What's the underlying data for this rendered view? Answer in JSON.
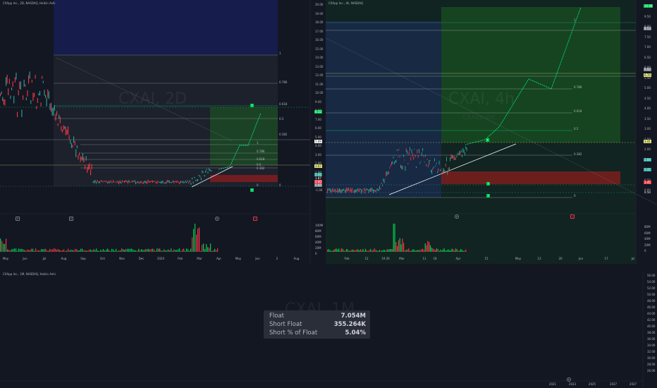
{
  "panes": {
    "left": {
      "title": "CXApp Inc., 2D, NASDAQ, Heikin Ashi",
      "watermark": "CXAI, 2D",
      "y_axis": [
        "20.00",
        "19.00",
        "18.00",
        "17.00",
        "16.00",
        "15.00",
        "14.00",
        "13.00",
        "12.00",
        "11.00",
        "10.00",
        "9.00",
        "8.00",
        "7.00",
        "6.00",
        "5.00",
        "4.00",
        "3.00",
        "2.00",
        "1.00",
        "0.00",
        "-1.00"
      ],
      "x_axis": [
        "May",
        "Jun",
        "Jul",
        "Aug",
        "Sep",
        "Oct",
        "Nov",
        "Dec",
        "2024",
        "Feb",
        "Mar",
        "Apr",
        "May",
        "Jun",
        "2",
        "Aug"
      ],
      "volume_axis": [
        "100M",
        "80M",
        "60M",
        "40M",
        "20M",
        "0"
      ],
      "fib_labels": [
        "1",
        "0.786",
        "0.618",
        "0.5",
        "0.382",
        "0"
      ],
      "fib_labels_small": [
        "1",
        "0.786",
        "0.618",
        "0.5",
        "0.382",
        "0"
      ],
      "price_tags": [
        "6.32",
        "5.89",
        "3.67",
        "2.41",
        "1.87",
        "0.80",
        "0.60"
      ],
      "events": [
        "E",
        "D",
        "D",
        "S"
      ]
    },
    "right": {
      "title": "CXApp Inc., 4h, NASDAQ",
      "watermark": "CXAI, 4h",
      "subtitle": "CXApp Inc.",
      "y_axis": [
        "10.00",
        "9.50",
        "8.00",
        "7.50",
        "7.00",
        "6.50",
        "6.00",
        "5.50",
        "5.00",
        "4.50",
        "4.00",
        "3.50",
        "3.00",
        "2.50",
        "2.00",
        "1.50",
        "1.00",
        "0.50",
        "0.00"
      ],
      "x_axis": [
        "Feb",
        "12",
        "19 26",
        "Mar",
        "11",
        "18",
        "Apr",
        "15",
        "May",
        "13",
        "20",
        "Jun",
        "17",
        "Jul"
      ],
      "volume_axis": [
        "80M",
        "60M",
        "40M",
        "20M",
        "0"
      ],
      "fib_labels": [
        "1",
        "0.786",
        "0.618",
        "0.5",
        "0.382",
        "0"
      ],
      "price_tags": [
        "10.00",
        "8.53",
        "6.92",
        "6.70",
        "3.41",
        "2.84",
        "2.41",
        "1.45",
        "0.50"
      ],
      "events": [
        "D",
        "S"
      ]
    },
    "bottom": {
      "title": "CXApp Inc., 1M, NASDAQ, Heikin Ashi",
      "watermark": "CXAI, 1M",
      "y_axis": [
        "56.00",
        "54.00",
        "52.00",
        "50.00",
        "48.00",
        "46.00",
        "44.00",
        "42.00",
        "40.00",
        "38.00",
        "36.00",
        "34.00",
        "32.00",
        "30.00",
        "28.00",
        "26.00"
      ],
      "x_axis": [
        "2021",
        "2023",
        "2025",
        "2027",
        "2027"
      ],
      "events": [
        "D"
      ]
    }
  },
  "float_table": {
    "rows": [
      {
        "label": "Float",
        "value": "7.054M"
      },
      {
        "label": "Short Float",
        "value": "355.264K"
      },
      {
        "label": "Short % of Float",
        "value": "5.04%"
      }
    ]
  },
  "colors": {
    "background": "#131722",
    "bull": "#26a69a",
    "green_candle": "#00c853",
    "bear": "#f23645",
    "projection": "#00e676",
    "fib_line": "#b2b5be",
    "target_zone": "#1b5e20",
    "stop_zone": "#7f1d1d"
  }
}
